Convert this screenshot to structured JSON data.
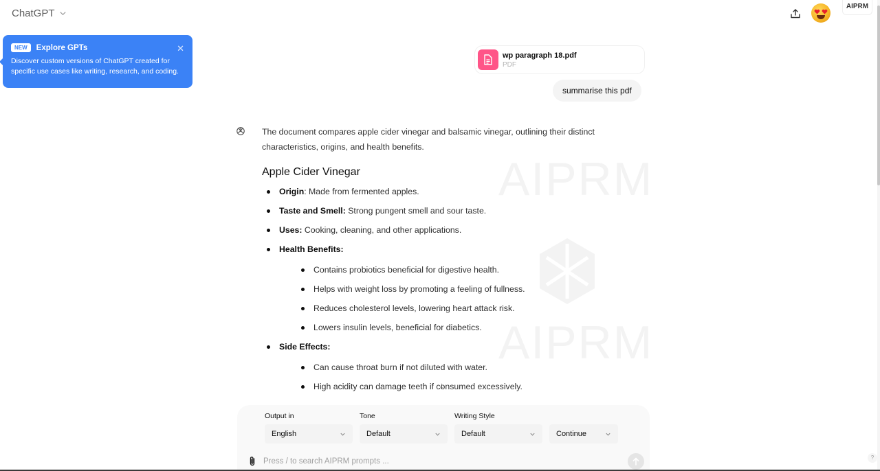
{
  "header": {
    "model_name": "ChatGPT",
    "share_icon": "share-upload-icon",
    "avatar_icon": "heart-eyes-emoji-avatar",
    "aiprm_tab": "AIPRM"
  },
  "popover": {
    "badge": "NEW",
    "title": "Explore GPTs",
    "description": "Discover custom versions of ChatGPT created for specific use cases like writing, research, and coding.",
    "close_icon": "close-icon"
  },
  "attachment": {
    "file_name": "wp paragraph 18.pdf",
    "file_type": "PDF",
    "icon": "document-icon",
    "color": "#ff5588"
  },
  "user_message": "summarise this pdf",
  "assistant": {
    "intro": "The document compares apple cider vinegar and balsamic vinegar, outlining their distinct characteristics, origins, and health benefits.",
    "section_title": "Apple Cider Vinegar",
    "items": [
      {
        "label": "Origin",
        "text": ": Made from fermented apples."
      },
      {
        "label": "Taste and Smell:",
        "text": " Strong pungent smell and sour taste."
      },
      {
        "label": "Uses:",
        "text": " Cooking, cleaning, and other applications."
      },
      {
        "label": "Health Benefits:",
        "text": ""
      },
      {
        "label": "Side Effects:",
        "text": ""
      }
    ],
    "health_benefits": [
      "Contains probiotics beneficial for digestive health.",
      "Helps with weight loss by promoting a feeling of fullness.",
      "Reduces cholesterol levels, lowering heart attack risk.",
      "Lowers insulin levels, beneficial for diabetics."
    ],
    "side_effects": [
      "Can cause throat burn if not diluted with water.",
      "High acidity can damage teeth if consumed excessively."
    ]
  },
  "watermark": "AIPRM",
  "composer": {
    "output_label": "Output in",
    "output_value": "English",
    "tone_label": "Tone",
    "tone_value": "Default",
    "style_label": "Writing Style",
    "style_value": "Default",
    "continue_label": "Continue",
    "placeholder": "Press / to search AIPRM prompts ...",
    "attach_icon": "paperclip-icon",
    "send_icon": "arrow-up-icon"
  },
  "help_label": "?"
}
